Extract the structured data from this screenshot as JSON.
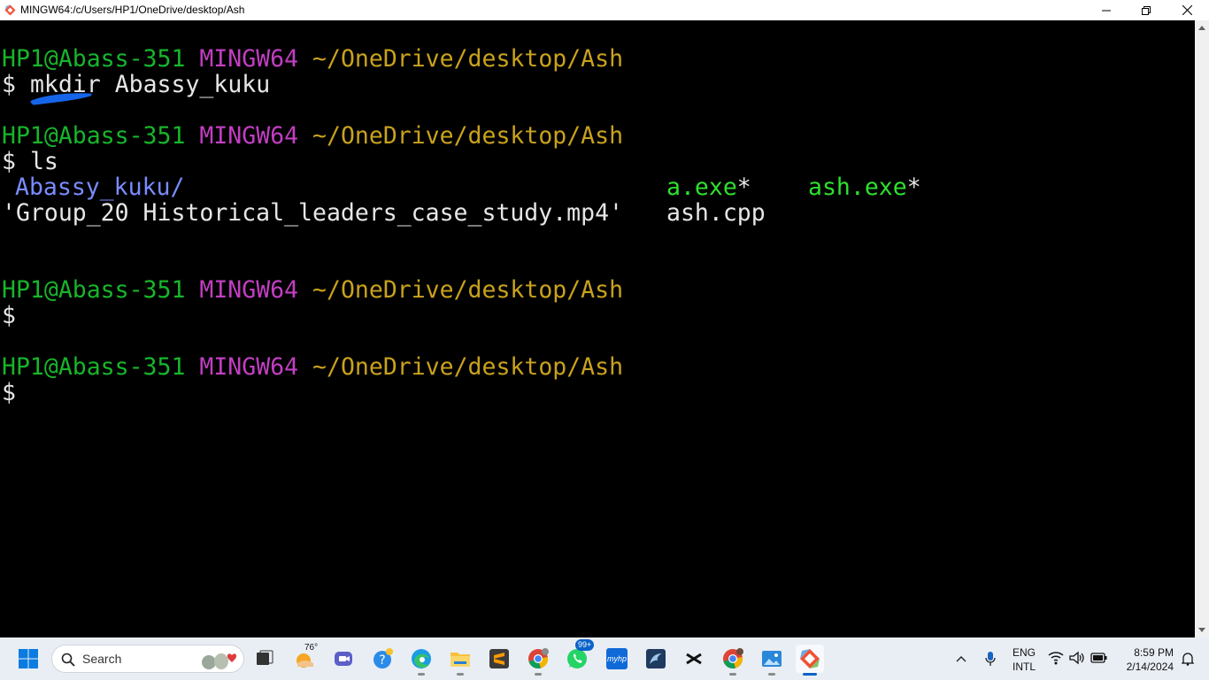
{
  "window": {
    "title": "MINGW64:/c/Users/HP1/OneDrive/desktop/Ash"
  },
  "terminal": {
    "blocks": [
      {
        "user_host": "HP1@Abass-351",
        "shell": "MINGW64",
        "path": "~/OneDrive/desktop/Ash",
        "prompt": "$",
        "command_word": "mkdir",
        "command_args": "Abassy_kuku"
      },
      {
        "user_host": "HP1@Abass-351",
        "shell": "MINGW64",
        "path": "~/OneDrive/desktop/Ash",
        "prompt": "$",
        "command": "ls"
      },
      {
        "user_host": "HP1@Abass-351",
        "shell": "MINGW64",
        "path": "~/OneDrive/desktop/Ash",
        "prompt": "$"
      },
      {
        "user_host": "HP1@Abass-351",
        "shell": "MINGW64",
        "path": "~/OneDrive/desktop/Ash",
        "prompt": "$"
      }
    ],
    "ls_output": {
      "dir_entry": "Abassy_kuku/",
      "file_mp4": "'Group_20 Historical_leaders_case_study.mp4'",
      "exe1": "a.exe",
      "exe2": "ash.exe",
      "exe_marker": "*",
      "cpp": "ash.cpp"
    },
    "colors": {
      "user_host": "#17b52b",
      "shell": "#c23ec2",
      "path": "#c9a21c",
      "directory": "#7a8cff",
      "executable": "#2ee02e",
      "annotation": "#1565e8"
    }
  },
  "taskbar": {
    "search_placeholder": "Search",
    "weather_temp": "76°",
    "whatsapp_badge": "99+",
    "hp_label": "myhp",
    "apps": [
      "start-icon",
      "search-icon",
      "widgets-icon",
      "task-view-icon",
      "weather-icon",
      "teams-icon",
      "help-icon",
      "edge-icon",
      "file-explorer-icon",
      "sublime-text-icon",
      "chrome-icon",
      "whatsapp-icon",
      "myhp-icon",
      "mysql-workbench-icon",
      "capcut-icon",
      "chrome-profile-icon",
      "photos-icon",
      "git-bash-icon"
    ],
    "tray": {
      "language": "ENG",
      "layout": "INTL",
      "time": "8:59 PM",
      "date": "2/14/2024"
    }
  }
}
